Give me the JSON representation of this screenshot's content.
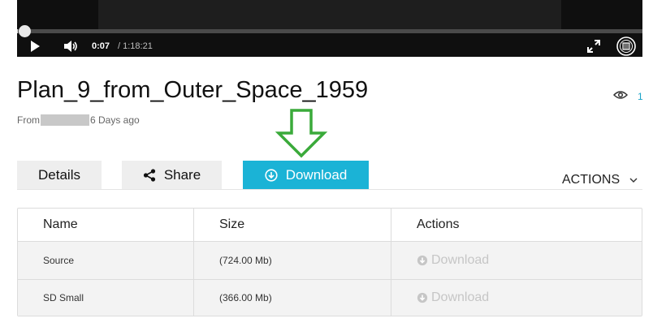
{
  "player": {
    "current_time": "0:07",
    "total_time": "/ 1:18:21",
    "progress": 0.001
  },
  "video": {
    "title": "Plan_9_from_Outer_Space_1959",
    "views_count": "1",
    "meta_from": "From",
    "meta_age": "6 Days ago"
  },
  "tabs": {
    "details": "Details",
    "share": "Share",
    "download": "Download"
  },
  "actions_menu": {
    "label": "ACTIONS"
  },
  "table": {
    "headers": [
      "Name",
      "Size",
      "Actions"
    ],
    "rows": [
      {
        "name": "Source",
        "size": "(724.00 Mb)",
        "action": "Download"
      },
      {
        "name": "SD Small",
        "size": "(366.00 Mb)",
        "action": "Download"
      }
    ]
  },
  "colors": {
    "accent": "#1bb3d6",
    "annotation_arrow": "#3aaa3a",
    "disabled_link": "#c6c6c6"
  },
  "icons": {
    "play": "play-icon",
    "volume": "volume-icon",
    "fullscreen": "fullscreen-icon",
    "badge": "logo-badge-icon",
    "views": "eye-icon",
    "share": "share-icon",
    "download": "download-circle-icon",
    "chevron": "chevron-down-icon"
  }
}
